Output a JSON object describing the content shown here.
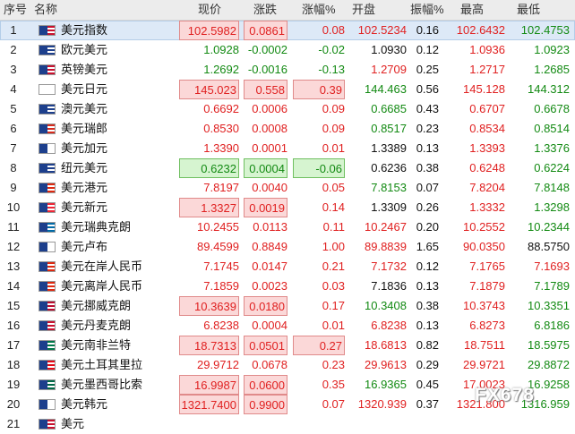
{
  "header": {
    "idx": "序号",
    "name": "名称",
    "price": "现价",
    "chg": "涨跌",
    "pct": "涨幅%",
    "open": "开盘",
    "amp": "振幅%",
    "high": "最高",
    "low": "最低"
  },
  "colors": {
    "up": "#e02121",
    "down": "#138a13",
    "neutral": "#111111",
    "selected_row": "#dde9f7"
  },
  "watermark": "FX678",
  "rows": [
    {
      "idx": "1",
      "name": "美元指数",
      "price": "102.5982",
      "chg": "0.0861",
      "pct": "0.08",
      "open": "102.5234",
      "amp": "0.16",
      "high": "102.6432",
      "low": "102.4753",
      "pc": "up",
      "cc": "up",
      "tc": "up",
      "oc": "up",
      "hc": "up",
      "lc": "dn",
      "box": "up",
      "pbox": false,
      "sel": true,
      "flag": "us"
    },
    {
      "idx": "2",
      "name": "欧元美元",
      "price": "1.0928",
      "chg": "-0.0002",
      "pct": "-0.02",
      "open": "1.0930",
      "amp": "0.12",
      "high": "1.0936",
      "low": "1.0923",
      "pc": "dn",
      "cc": "dn",
      "tc": "dn",
      "oc": "neu",
      "hc": "up",
      "lc": "dn",
      "box": "",
      "pbox": false,
      "flag": "eu"
    },
    {
      "idx": "3",
      "name": "英镑美元",
      "price": "1.2692",
      "chg": "-0.0016",
      "pct": "-0.13",
      "open": "1.2709",
      "amp": "0.25",
      "high": "1.2717",
      "low": "1.2685",
      "pc": "dn",
      "cc": "dn",
      "tc": "dn",
      "oc": "up",
      "hc": "up",
      "lc": "dn",
      "box": "",
      "pbox": false,
      "flag": "gb"
    },
    {
      "idx": "4",
      "name": "美元日元",
      "price": "145.023",
      "chg": "0.558",
      "pct": "0.39",
      "open": "144.463",
      "amp": "0.56",
      "high": "145.128",
      "low": "144.312",
      "pc": "up",
      "cc": "up",
      "tc": "up",
      "oc": "dn",
      "hc": "up",
      "lc": "dn",
      "box": "up",
      "pbox": true,
      "flag": "jp"
    },
    {
      "idx": "5",
      "name": "澳元美元",
      "price": "0.6692",
      "chg": "0.0006",
      "pct": "0.09",
      "open": "0.6685",
      "amp": "0.43",
      "high": "0.6707",
      "low": "0.6678",
      "pc": "up",
      "cc": "up",
      "tc": "up",
      "oc": "dn",
      "hc": "up",
      "lc": "dn",
      "box": "",
      "pbox": false,
      "flag": "au"
    },
    {
      "idx": "6",
      "name": "美元瑞郎",
      "price": "0.8530",
      "chg": "0.0008",
      "pct": "0.09",
      "open": "0.8517",
      "amp": "0.23",
      "high": "0.8534",
      "low": "0.8514",
      "pc": "up",
      "cc": "up",
      "tc": "up",
      "oc": "dn",
      "hc": "up",
      "lc": "dn",
      "box": "",
      "pbox": false,
      "flag": "ch"
    },
    {
      "idx": "7",
      "name": "美元加元",
      "price": "1.3390",
      "chg": "0.0001",
      "pct": "0.01",
      "open": "1.3389",
      "amp": "0.13",
      "high": "1.3393",
      "low": "1.3376",
      "pc": "up",
      "cc": "up",
      "tc": "up",
      "oc": "neu",
      "hc": "up",
      "lc": "dn",
      "box": "",
      "pbox": false,
      "flag": "ca"
    },
    {
      "idx": "8",
      "name": "纽元美元",
      "price": "0.6232",
      "chg": "0.0004",
      "pct": "-0.06",
      "open": "0.6236",
      "amp": "0.38",
      "high": "0.6248",
      "low": "0.6224",
      "pc": "dn",
      "cc": "dn",
      "tc": "dn",
      "oc": "neu",
      "hc": "up",
      "lc": "dn",
      "box": "dn",
      "pbox": true,
      "flag": "nz"
    },
    {
      "idx": "9",
      "name": "美元港元",
      "price": "7.8197",
      "chg": "0.0040",
      "pct": "0.05",
      "open": "7.8153",
      "amp": "0.07",
      "high": "7.8204",
      "low": "7.8148",
      "pc": "up",
      "cc": "up",
      "tc": "up",
      "oc": "dn",
      "hc": "up",
      "lc": "dn",
      "box": "",
      "pbox": false,
      "flag": "hk"
    },
    {
      "idx": "10",
      "name": "美元新元",
      "price": "1.3327",
      "chg": "0.0019",
      "pct": "0.14",
      "open": "1.3309",
      "amp": "0.26",
      "high": "1.3332",
      "low": "1.3298",
      "pc": "up",
      "cc": "up",
      "tc": "up",
      "oc": "neu",
      "hc": "up",
      "lc": "dn",
      "box": "up",
      "pbox": false,
      "flag": "sg"
    },
    {
      "idx": "11",
      "name": "美元瑞典克朗",
      "price": "10.2455",
      "chg": "0.0113",
      "pct": "0.11",
      "open": "10.2467",
      "amp": "0.20",
      "high": "10.2552",
      "low": "10.2344",
      "pc": "up",
      "cc": "up",
      "tc": "up",
      "oc": "up",
      "hc": "up",
      "lc": "dn",
      "box": "",
      "pbox": false,
      "flag": "se"
    },
    {
      "idx": "12",
      "name": "美元卢布",
      "price": "89.4599",
      "chg": "0.8849",
      "pct": "1.00",
      "open": "89.8839",
      "amp": "1.65",
      "high": "90.0350",
      "low": "88.5750",
      "pc": "up",
      "cc": "up",
      "tc": "up",
      "oc": "up",
      "hc": "up",
      "lc": "neu",
      "box": "",
      "pbox": false,
      "flag": "ru"
    },
    {
      "idx": "13",
      "name": "美元在岸人民币",
      "price": "7.1745",
      "chg": "0.0147",
      "pct": "0.21",
      "open": "7.1732",
      "amp": "0.12",
      "high": "7.1765",
      "low": "7.1693",
      "pc": "up",
      "cc": "up",
      "tc": "up",
      "oc": "up",
      "hc": "up",
      "lc": "up",
      "box": "",
      "pbox": false,
      "flag": "cn"
    },
    {
      "idx": "14",
      "name": "美元离岸人民币",
      "price": "7.1859",
      "chg": "0.0023",
      "pct": "0.03",
      "open": "7.1836",
      "amp": "0.13",
      "high": "7.1879",
      "low": "7.1789",
      "pc": "up",
      "cc": "up",
      "tc": "up",
      "oc": "neu",
      "hc": "up",
      "lc": "dn",
      "box": "",
      "pbox": false,
      "flag": "cn"
    },
    {
      "idx": "15",
      "name": "美元挪威克朗",
      "price": "10.3639",
      "chg": "0.0180",
      "pct": "0.17",
      "open": "10.3408",
      "amp": "0.38",
      "high": "10.3743",
      "low": "10.3351",
      "pc": "up",
      "cc": "up",
      "tc": "up",
      "oc": "dn",
      "hc": "up",
      "lc": "dn",
      "box": "up",
      "pbox": false,
      "flag": "no"
    },
    {
      "idx": "16",
      "name": "美元丹麦克朗",
      "price": "6.8238",
      "chg": "0.0004",
      "pct": "0.01",
      "open": "6.8238",
      "amp": "0.13",
      "high": "6.8273",
      "low": "6.8186",
      "pc": "up",
      "cc": "up",
      "tc": "up",
      "oc": "up",
      "hc": "up",
      "lc": "dn",
      "box": "",
      "pbox": false,
      "flag": "dk"
    },
    {
      "idx": "17",
      "name": "美元南非兰特",
      "price": "18.7313",
      "chg": "0.0501",
      "pct": "0.27",
      "open": "18.6813",
      "amp": "0.82",
      "high": "18.7511",
      "low": "18.5975",
      "pc": "up",
      "cc": "up",
      "tc": "up",
      "oc": "up",
      "hc": "up",
      "lc": "dn",
      "box": "up",
      "pbox": true,
      "flag": "za"
    },
    {
      "idx": "18",
      "name": "美元土耳其里拉",
      "price": "29.9712",
      "chg": "0.0678",
      "pct": "0.23",
      "open": "29.9613",
      "amp": "0.29",
      "high": "29.9721",
      "low": "29.8872",
      "pc": "up",
      "cc": "up",
      "tc": "up",
      "oc": "up",
      "hc": "up",
      "lc": "dn",
      "box": "",
      "pbox": false,
      "flag": "tr"
    },
    {
      "idx": "19",
      "name": "美元墨西哥比索",
      "price": "16.9987",
      "chg": "0.0600",
      "pct": "0.35",
      "open": "16.9365",
      "amp": "0.45",
      "high": "17.0023",
      "low": "16.9258",
      "pc": "up",
      "cc": "up",
      "tc": "up",
      "oc": "dn",
      "hc": "up",
      "lc": "dn",
      "box": "up",
      "pbox": false,
      "flag": "mx"
    },
    {
      "idx": "20",
      "name": "美元韩元",
      "price": "1321.7400",
      "chg": "0.9900",
      "pct": "0.07",
      "open": "1320.939",
      "amp": "0.37",
      "high": "1321.800",
      "low": "1316.959",
      "pc": "up",
      "cc": "up",
      "tc": "up",
      "oc": "up",
      "hc": "up",
      "lc": "dn",
      "box": "up",
      "pbox": false,
      "flag": "kr"
    },
    {
      "idx": "21",
      "name": "美元",
      "price": "",
      "chg": "",
      "pct": "",
      "open": "",
      "amp": "",
      "high": "",
      "low": "",
      "pc": "up",
      "cc": "up",
      "tc": "up",
      "oc": "up",
      "hc": "up",
      "lc": "dn",
      "box": "",
      "pbox": false,
      "flag": "us"
    }
  ]
}
